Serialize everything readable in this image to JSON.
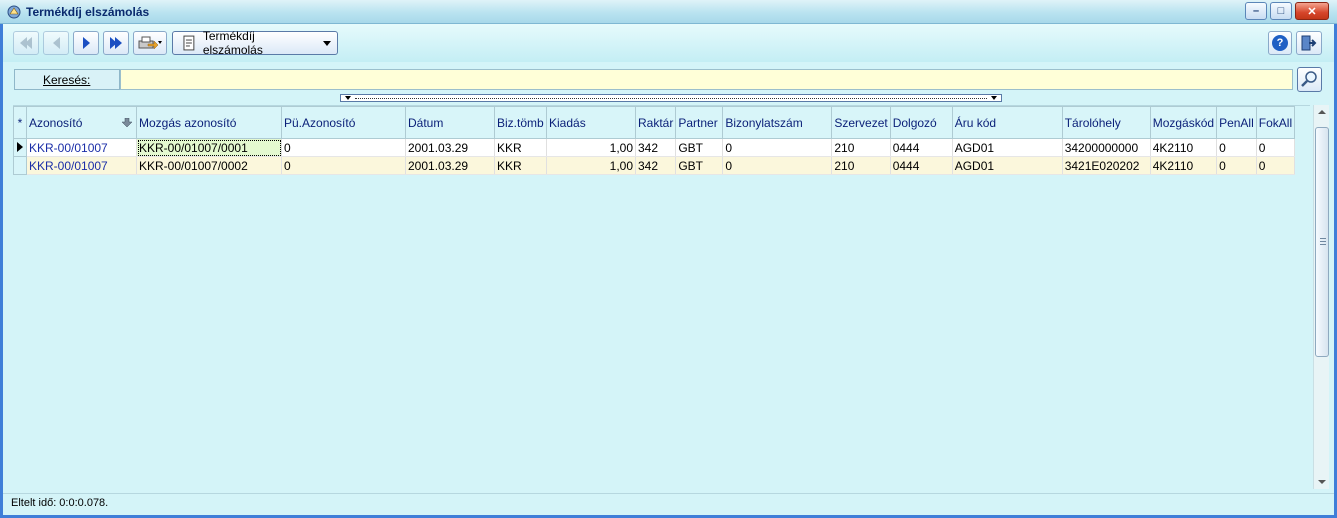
{
  "window": {
    "title": "Termékdíj elszámolás",
    "buttons": {
      "minimize": "–",
      "maximize": "□",
      "close": "✕"
    }
  },
  "toolbar": {
    "first_icon": "first-record-icon",
    "prev_icon": "previous-record-icon",
    "next_icon": "next-record-icon",
    "last_icon": "last-record-icon",
    "print_icon": "print-menu-icon",
    "report_label": "Termékdíj elszámolás",
    "help_label": "?",
    "exit_icon": "exit-icon"
  },
  "search": {
    "label": "Keresés:",
    "value": ""
  },
  "grid": {
    "columns": [
      "*",
      "Azonosító",
      "Mozgás azonosító",
      "Pü.Azonosító",
      "Dátum",
      "Biz.tömb",
      "Kiadás",
      "Raktár",
      "Partner",
      "Bizonylatszám",
      "Szervezet",
      "Dolgozó",
      "Áru kód",
      "Tárolóhely",
      "Mozgáskód",
      "PenAll",
      "FokAll"
    ],
    "rows": [
      [
        "KKR-00/01007",
        "KKR-00/01007/0001",
        "0",
        "2001.03.29",
        "KKR",
        "1,00",
        "342",
        "GBT",
        "0",
        "210",
        "0444",
        "AGD01",
        "34200000000",
        "4K2110",
        "0",
        "0"
      ],
      [
        "KKR-00/01007",
        "KKR-00/01007/0002",
        "0",
        "2001.03.29",
        "KKR",
        "1,00",
        "342",
        "GBT",
        "0",
        "210",
        "0444",
        "AGD01",
        "3421E020202",
        "4K2110",
        "0",
        "0"
      ]
    ]
  },
  "status": {
    "text": "Eltelt idő: 0:0:0.078."
  },
  "colors": {
    "background": "#d4f4f8",
    "header_text": "#0a1f78",
    "search_field": "#ffffd8",
    "alt_row": "#fbf7dc"
  }
}
